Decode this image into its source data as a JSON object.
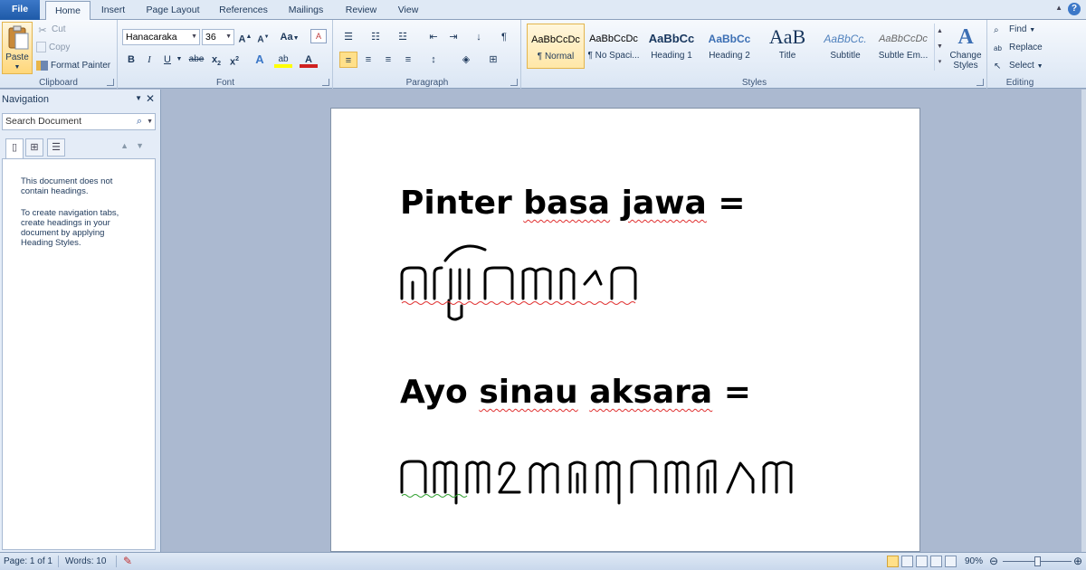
{
  "tabs": [
    {
      "label": "File"
    },
    {
      "label": "Home"
    },
    {
      "label": "Insert"
    },
    {
      "label": "Page Layout"
    },
    {
      "label": "References"
    },
    {
      "label": "Mailings"
    },
    {
      "label": "Review"
    },
    {
      "label": "View"
    }
  ],
  "clipboard": {
    "paste": "Paste",
    "cut": "Cut",
    "copy": "Copy",
    "format_painter": "Format Painter",
    "group_label": "Clipboard"
  },
  "font": {
    "family": "Hanacaraka",
    "size": "36",
    "change_case": "Aa",
    "group_label": "Font"
  },
  "paragraph": {
    "group_label": "Paragraph"
  },
  "styles": {
    "group_label": "Styles",
    "items": [
      {
        "sample": "AaBbCcDc",
        "name": "¶ Normal"
      },
      {
        "sample": "AaBbCcDc",
        "name": "¶ No Spaci..."
      },
      {
        "sample": "AaBbCc",
        "name": "Heading 1"
      },
      {
        "sample": "AaBbCc",
        "name": "Heading 2"
      },
      {
        "sample": "AaB",
        "name": "Title"
      },
      {
        "sample": "AaBbCc.",
        "name": "Subtitle"
      },
      {
        "sample": "AaBbCcDc",
        "name": "Subtle Em..."
      }
    ],
    "change_styles": "Change Styles"
  },
  "editing": {
    "find": "Find",
    "replace": "Replace",
    "select": "Select",
    "group_label": "Editing"
  },
  "navigation": {
    "title": "Navigation",
    "search_placeholder": "Search Document",
    "msg1": "This document does not contain headings.",
    "msg2": "To create navigation tabs, create headings in your document by applying Heading Styles."
  },
  "document": {
    "line1": "Pinter basa jawa =",
    "line2": "Ayo sinau aksara ="
  },
  "statusbar": {
    "page": "Page: 1 of 1",
    "words": "Words: 10",
    "zoom": "90%"
  }
}
